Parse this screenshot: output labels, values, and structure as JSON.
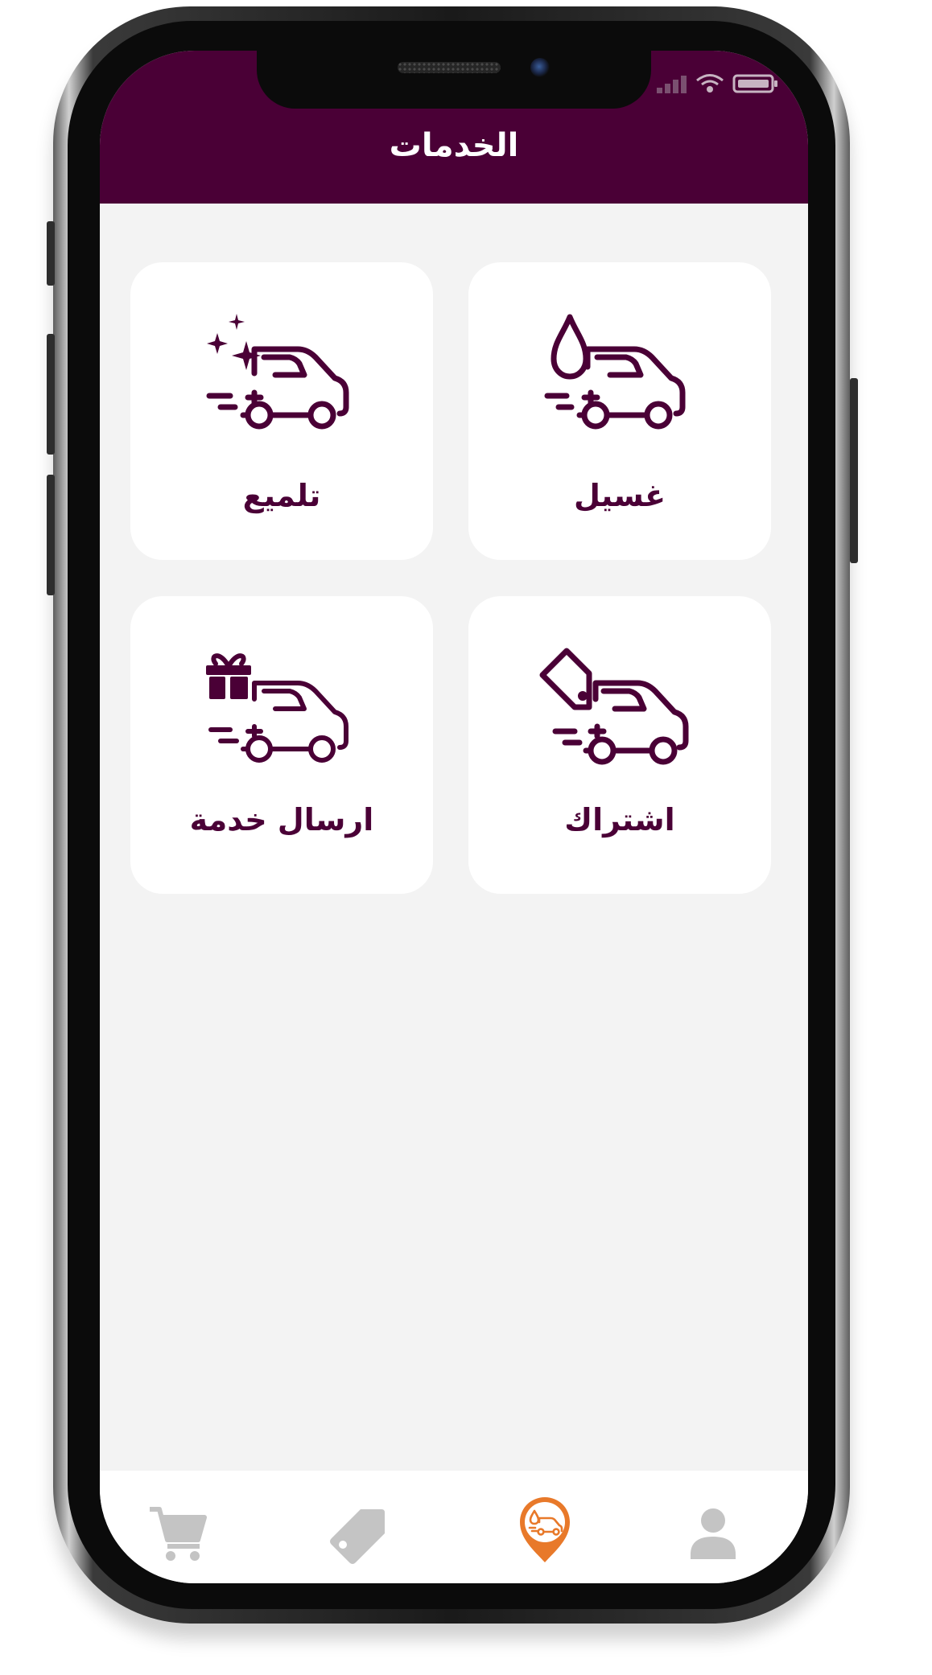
{
  "header": {
    "title": "الخدمات"
  },
  "services": [
    {
      "label": "غسيل",
      "icon": "car-wash-drop-icon"
    },
    {
      "label": "تلميع",
      "icon": "car-polish-sparkle-icon"
    },
    {
      "label": "اشتراك",
      "icon": "car-tag-subscription-icon"
    },
    {
      "label": "ارسال خدمة",
      "icon": "car-gift-delivery-icon"
    }
  ],
  "bottom_nav": [
    {
      "name": "profile",
      "icon": "person-icon",
      "active": false
    },
    {
      "name": "services",
      "icon": "location-pin-car-icon",
      "active": true
    },
    {
      "name": "offers",
      "icon": "tag-icon",
      "active": false
    },
    {
      "name": "cart",
      "icon": "cart-icon",
      "active": false
    }
  ],
  "colors": {
    "brand": "#4a0036",
    "accent": "#e8792a",
    "inactive_icon": "#c4c4c4",
    "background": "#f3f3f3"
  }
}
